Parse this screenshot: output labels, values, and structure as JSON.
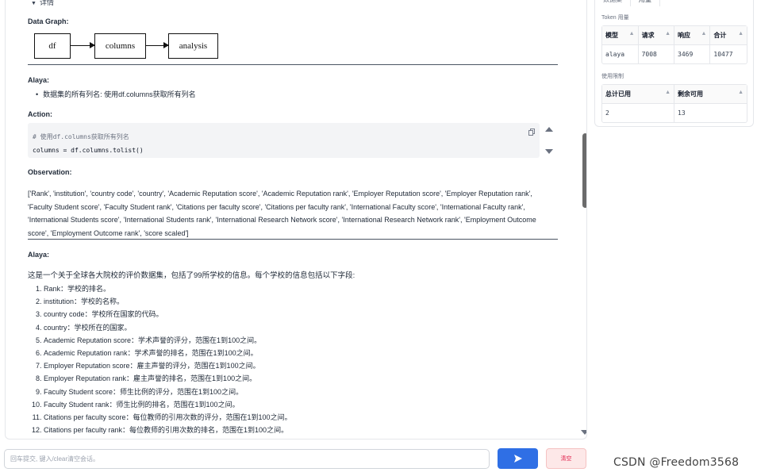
{
  "details": {
    "label": "详情"
  },
  "data_graph": {
    "label": "Data Graph:",
    "nodes": [
      "df",
      "columns",
      "analysis"
    ]
  },
  "alaya_1": {
    "label": "Alaya:",
    "bullet": "数据集的所有列名: 使用df.columns获取所有列名"
  },
  "action": {
    "label": "Action:",
    "comment": "# 使用df.columns获取所有列名",
    "code": "columns = df.columns.tolist()"
  },
  "observation": {
    "label": "Observation:",
    "text": "['Rank', 'institution', 'country code', 'country', 'Academic Reputation score', 'Academic Reputation rank', 'Employer Reputation score', 'Employer Reputation rank', 'Faculty Student score', 'Faculty Student rank', 'Citations per faculty score', 'Citations per faculty rank', 'International Faculty score', 'International Faculty rank', 'International Students score', 'International Students rank', 'International Research Network score', 'International Research Network rank', 'Employment Outcome score', 'Employment Outcome rank', 'score scaled']"
  },
  "alaya_2": {
    "label": "Alaya:",
    "intro": "这是一个关于全球各大院校的评价数据集，包括了99所学校的信息。每个学校的信息包括以下字段:",
    "items": [
      "Rank：学校的排名。",
      "institution：学校的名称。",
      "country code：学校所在国家的代码。",
      "country：学校所在的国家。",
      "Academic Reputation score：学术声誉的评分，范围在1到100之间。",
      "Academic Reputation rank：学术声誉的排名，范围在1到100之间。",
      "Employer Reputation score：雇主声誉的评分，范围在1到100之间。",
      "Employer Reputation rank：雇主声誉的排名，范围在1到100之间。",
      "Faculty Student score：师生比例的评分，范围在1到100之间。",
      "Faculty Student rank：师生比例的排名，范围在1到100之间。",
      "Citations per faculty score：每位教师的引用次数的评分，范围在1到100之间。",
      "Citations per faculty rank：每位教师的引用次数的排名，范围在1到100之间。"
    ]
  },
  "right_panel": {
    "tabs": [
      "数据集",
      "用量"
    ],
    "token_label": "Token 用量",
    "token_table": {
      "headers": [
        "模型",
        "请求",
        "响应",
        "合计"
      ],
      "rows": [
        [
          "alaya",
          "7008",
          "3469",
          "10477"
        ]
      ]
    },
    "limit_label": "使用限制",
    "limit_table": {
      "headers": [
        "总计已用",
        "剩余可用"
      ],
      "rows": [
        [
          "2",
          "13"
        ]
      ]
    }
  },
  "input": {
    "placeholder": "回车提交, 键入/clear清空会话。"
  },
  "buttons": {
    "clear": "清空"
  },
  "watermark": "CSDN @Freedom3568",
  "colors": {
    "send": "#2f6fe5",
    "clear_bg": "#fde8e8",
    "clear_text": "#e11d48"
  }
}
